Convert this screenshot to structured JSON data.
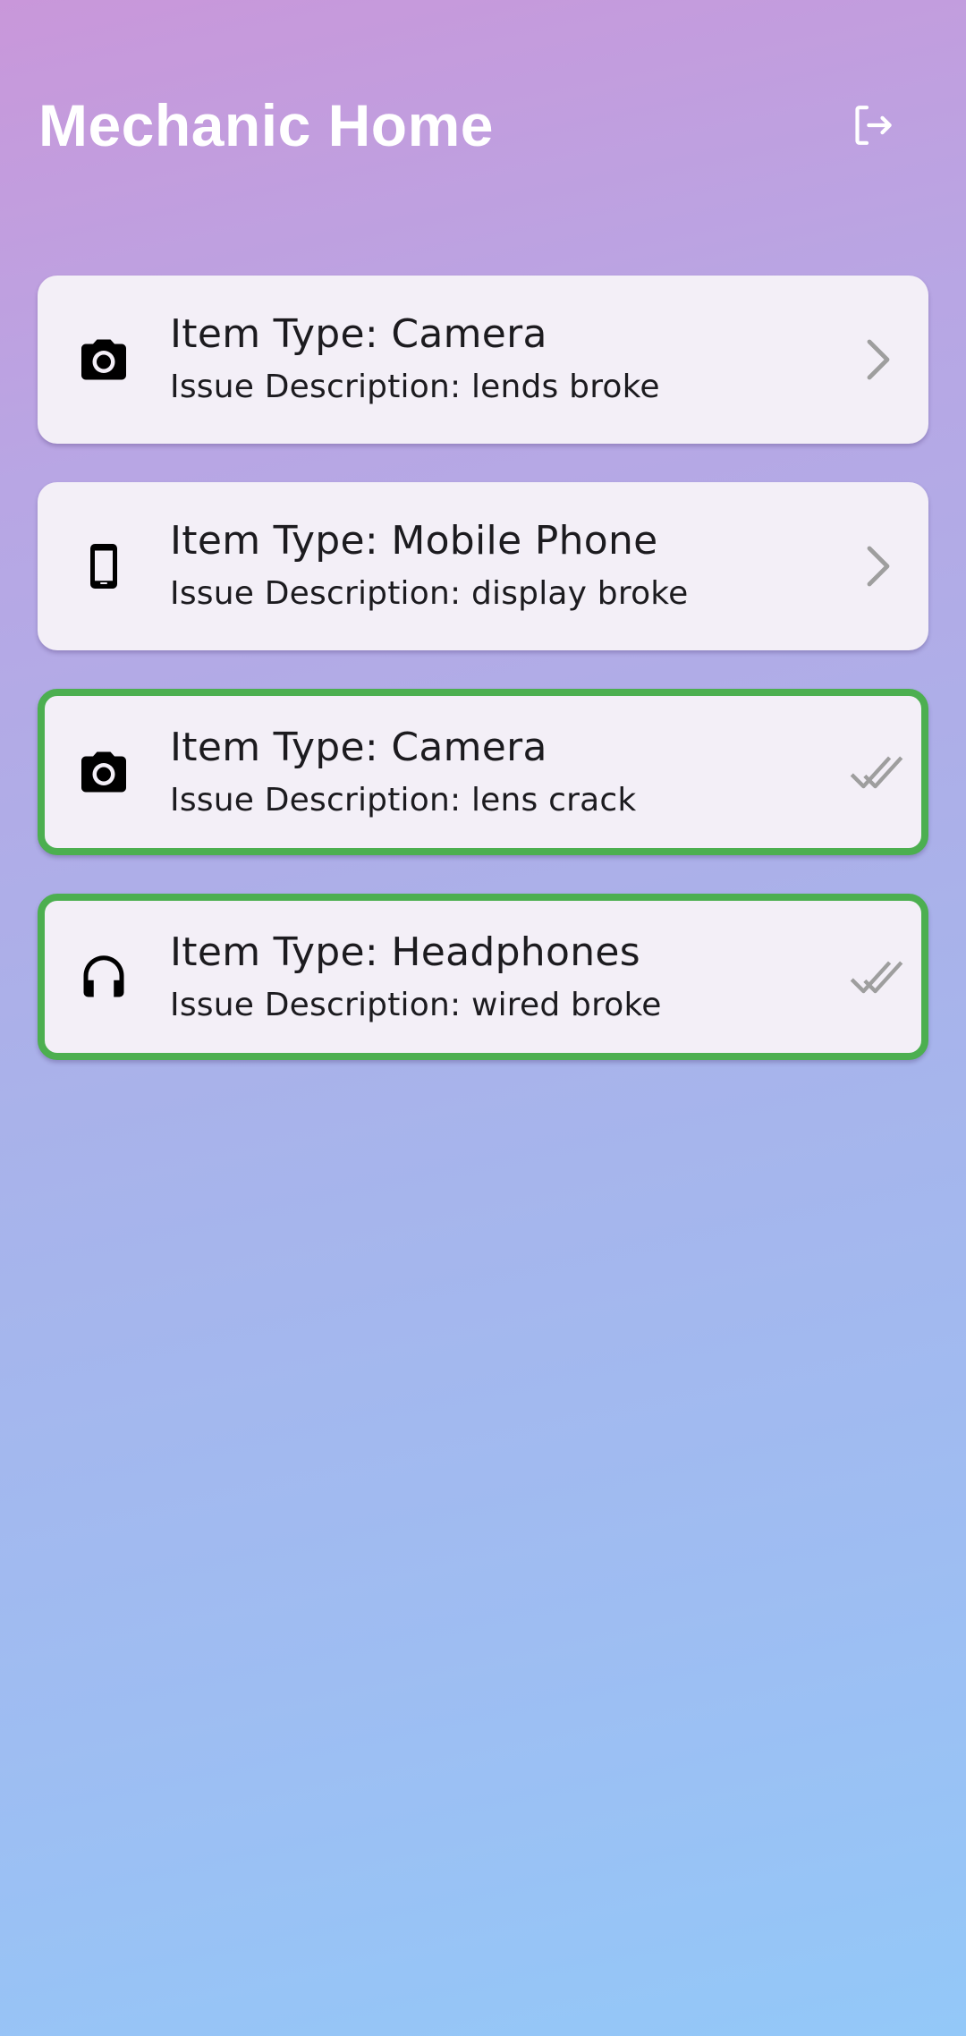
{
  "app_bar": {
    "title": "Mechanic Home",
    "logout_icon": "logout-icon"
  },
  "colors": {
    "done_border": "#4caf50",
    "card_bg": "#f3eff7",
    "chevron": "#9e9e9e",
    "title_text": "#ffffff"
  },
  "items": [
    {
      "icon": "camera-icon",
      "title": "Item Type: Camera",
      "subtitle": "Issue Description: lends broke",
      "status": "pending",
      "trailing_icon": "chevron-right-icon"
    },
    {
      "icon": "mobile-phone-icon",
      "title": "Item Type: Mobile Phone",
      "subtitle": "Issue Description: display broke",
      "status": "pending",
      "trailing_icon": "chevron-right-icon"
    },
    {
      "icon": "camera-icon",
      "title": "Item Type: Camera",
      "subtitle": "Issue Description: lens crack",
      "status": "done",
      "trailing_icon": "done-all-icon"
    },
    {
      "icon": "headphones-icon",
      "title": "Item Type: Headphones",
      "subtitle": "Issue Description: wired broke",
      "status": "done",
      "trailing_icon": "done-all-icon"
    }
  ]
}
